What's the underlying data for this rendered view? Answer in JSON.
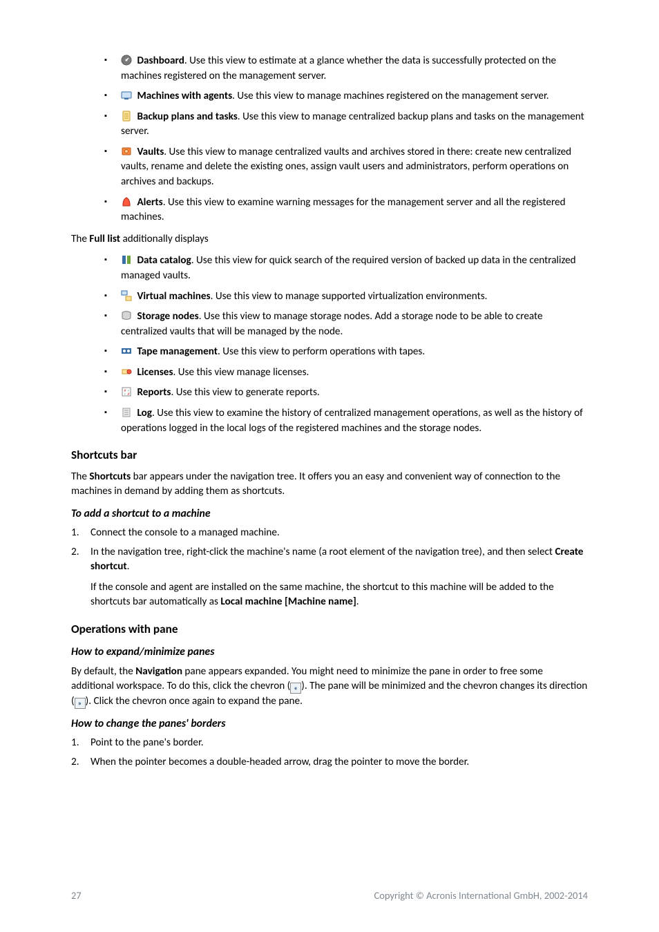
{
  "list_a": [
    {
      "icon": "dashboard-icon",
      "title": "Dashboard",
      "rest": ". Use this view to estimate at a glance whether the data is successfully protected on the machines registered on the management server."
    },
    {
      "icon": "machines-agents-icon",
      "title": "Machines with agents",
      "rest": ". Use this view to manage machines registered on the management server."
    },
    {
      "icon": "backup-plans-icon",
      "title": "Backup plans and tasks",
      "rest": ". Use this view to manage centralized backup plans and tasks on the management server."
    },
    {
      "icon": "vaults-icon",
      "title": "Vaults",
      "rest": ". Use this view to manage centralized vaults and archives stored in there: create new centralized vaults, rename and delete the existing ones, assign vault users and administrators, perform operations on archives and backups."
    },
    {
      "icon": "alerts-icon",
      "title": "Alerts",
      "rest": ". Use this view to examine warning messages for the management server and all the registered machines."
    }
  ],
  "full_list_intro_pre": "The ",
  "full_list_intro_bold": "Full list",
  "full_list_intro_post": " additionally displays",
  "list_b": [
    {
      "icon": "data-catalog-icon",
      "title": "Data catalog",
      "rest": ". Use this view for quick search of the required version of backed up data in the centralized managed vaults."
    },
    {
      "icon": "virtual-machines-icon",
      "title": "Virtual machines",
      "rest": ". Use this view to manage supported virtualization environments."
    },
    {
      "icon": "storage-nodes-icon",
      "title": "Storage nodes",
      "rest": ". Use this view to manage storage nodes. Add a storage node to be able to create centralized vaults that will be managed by the node."
    },
    {
      "icon": "tape-mgmt-icon",
      "title": "Tape management",
      "rest": ". Use this view to perform operations with tapes."
    },
    {
      "icon": "licenses-icon",
      "title": "Licenses",
      "rest": ". Use this view manage licenses."
    },
    {
      "icon": "reports-icon",
      "title": "Reports",
      "rest": ". Use this view to generate reports."
    },
    {
      "icon": "log-icon",
      "title": "Log",
      "rest": ". Use this view to examine the history of centralized management operations, as well as the history of operations logged in the local logs of the registered machines and the storage nodes."
    }
  ],
  "shortcuts_heading": "Shortcuts bar",
  "shortcuts_p_pre": "The ",
  "shortcuts_p_bold": "Shortcuts",
  "shortcuts_p_post": " bar appears under the navigation tree. It offers you an easy and convenient way of connection to the machines in demand by adding them as shortcuts.",
  "add_shortcut_heading": "To add a shortcut to a machine",
  "add_shortcut_step1": "Connect the console to a managed machine.",
  "add_shortcut_step2_pre": "In the navigation tree, right-click the machine's name (a root element of the navigation tree), and then select ",
  "add_shortcut_step2_bold": "Create shortcut",
  "add_shortcut_step2_post": ".",
  "add_shortcut_step2_cont_pre": "If the console and agent are installed on the same machine, the shortcut to this machine will be added to the shortcuts bar automatically as ",
  "add_shortcut_step2_cont_bold": "Local machine [Machine name]",
  "add_shortcut_step2_cont_post": ".",
  "ops_heading": "Operations with pane",
  "expand_heading": "How to expand/minimize panes",
  "expand_p_pre": "By default, the ",
  "expand_p_bold": "Navigation",
  "expand_p_mid": " pane appears expanded. You might need to minimize the pane in order to free some additional workspace. To do this, click the chevron (",
  "expand_p_mid2": "). The pane will be minimized and the chevron changes its direction (",
  "expand_p_post": "). Click the chevron once again to expand the pane.",
  "borders_heading": "How to change the panes' borders",
  "borders_step1": "Point to the pane's border.",
  "borders_step2": "When the pointer becomes a double-headed arrow, drag the pointer to move the border.",
  "page_number": "27",
  "copyright": "Copyright © Acronis International GmbH, 2002-2014"
}
